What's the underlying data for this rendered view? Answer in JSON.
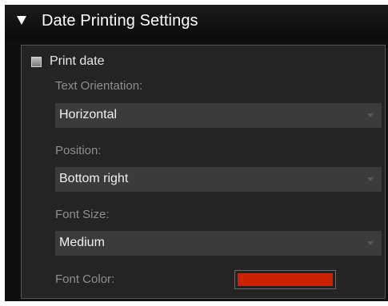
{
  "section": {
    "title": "Date Printing Settings",
    "expanded": true,
    "arrow_icon": "triangle-down-icon"
  },
  "print_date": {
    "label": "Print date",
    "checked": false
  },
  "text_orientation": {
    "label": "Text Orientation:",
    "value": "Horizontal"
  },
  "position": {
    "label": "Position:",
    "value": "Bottom right"
  },
  "font_size": {
    "label": "Font Size:",
    "value": "Medium"
  },
  "font_color": {
    "label": "Font Color:",
    "color": "#cc2200"
  },
  "colors": {
    "panel_background": "#0f0f0f",
    "group_background": "#242424",
    "select_background": "#3b3b3b",
    "label_text": "#8f8f8f",
    "value_text": "#f0f0f0"
  }
}
